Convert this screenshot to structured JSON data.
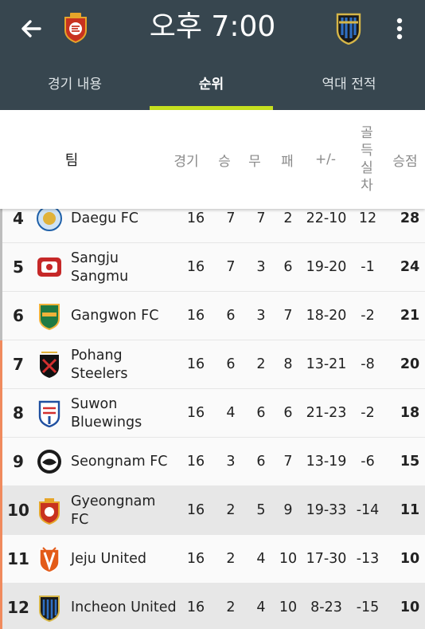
{
  "appbar": {
    "time": "오후 7:00",
    "home_logo": "gyeongnam-fc-crest",
    "away_logo": "incheon-united-crest",
    "back_icon": "arrow-left-icon",
    "menu_icon": "more-vertical-icon",
    "background_color": "#37464f",
    "indicator_color": "#c6e01f"
  },
  "tabs": [
    {
      "label": "경기 내용"
    },
    {
      "label": "순위"
    },
    {
      "label": "역대 전적"
    }
  ],
  "table": {
    "headers": {
      "team": "팀",
      "played": "경기",
      "win": "승",
      "draw": "무",
      "loss": "패",
      "goals": "+/-",
      "goal_diff": [
        "골",
        "득",
        "실",
        "차"
      ],
      "points": "승점"
    },
    "rows": [
      {
        "rank": "4",
        "team": [
          "Daegu FC"
        ],
        "played": "16",
        "win": "7",
        "draw": "7",
        "loss": "2",
        "goals": "22-10",
        "gd": "12",
        "pts": "28",
        "badge": "daegu-fc-crest",
        "bar": "#bdbdbd",
        "highlight": false
      },
      {
        "rank": "5",
        "team": [
          "Sangju",
          "Sangmu"
        ],
        "played": "16",
        "win": "7",
        "draw": "3",
        "loss": "6",
        "goals": "19-20",
        "gd": "-1",
        "pts": "24",
        "badge": "sangju-sangmu-crest",
        "bar": "#bdbdbd",
        "highlight": false
      },
      {
        "rank": "6",
        "team": [
          "Gangwon FC"
        ],
        "played": "16",
        "win": "6",
        "draw": "3",
        "loss": "7",
        "goals": "18-20",
        "gd": "-2",
        "pts": "21",
        "badge": "gangwon-fc-crest",
        "bar": "#bdbdbd",
        "highlight": false
      },
      {
        "rank": "7",
        "team": [
          "Pohang",
          "Steelers"
        ],
        "played": "16",
        "win": "6",
        "draw": "2",
        "loss": "8",
        "goals": "13-21",
        "gd": "-8",
        "pts": "20",
        "badge": "pohang-steelers-crest",
        "bar": "#f08a5d",
        "highlight": false
      },
      {
        "rank": "8",
        "team": [
          "Suwon",
          "Bluewings"
        ],
        "played": "16",
        "win": "4",
        "draw": "6",
        "loss": "6",
        "goals": "21-23",
        "gd": "-2",
        "pts": "18",
        "badge": "suwon-bluewings-crest",
        "bar": "#f08a5d",
        "highlight": false
      },
      {
        "rank": "9",
        "team": [
          "Seongnam FC"
        ],
        "played": "16",
        "win": "3",
        "draw": "6",
        "loss": "7",
        "goals": "13-19",
        "gd": "-6",
        "pts": "15",
        "badge": "seongnam-fc-crest",
        "bar": "#f08a5d",
        "highlight": false
      },
      {
        "rank": "10",
        "team": [
          "Gyeongnam",
          "FC"
        ],
        "played": "16",
        "win": "2",
        "draw": "5",
        "loss": "9",
        "goals": "19-33",
        "gd": "-14",
        "pts": "11",
        "badge": "gyeongnam-fc-crest",
        "bar": "#f08a5d",
        "highlight": true
      },
      {
        "rank": "11",
        "team": [
          "Jeju United"
        ],
        "played": "16",
        "win": "2",
        "draw": "4",
        "loss": "10",
        "goals": "17-30",
        "gd": "-13",
        "pts": "10",
        "badge": "jeju-united-crest",
        "bar": "#f08a5d",
        "highlight": false
      },
      {
        "rank": "12",
        "team": [
          "Incheon United"
        ],
        "played": "16",
        "win": "2",
        "draw": "4",
        "loss": "10",
        "goals": "8-23",
        "gd": "-15",
        "pts": "10",
        "badge": "incheon-united-crest",
        "bar": "#f08a5d",
        "highlight": true
      }
    ]
  }
}
